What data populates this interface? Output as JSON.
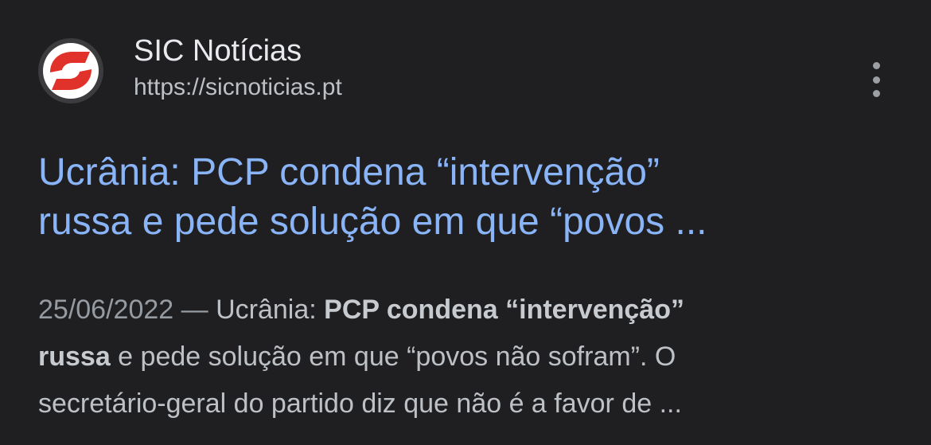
{
  "result": {
    "site_name": "SIC Notícias",
    "site_url": "https://sicnoticias.pt",
    "favicon_icon": "sic-logo-icon",
    "more_icon": "more-vert-icon",
    "title_line1": "Ucrânia: PCP condena “intervenção”",
    "title_line2": "russa e pede solução em que “povos ...",
    "snippet": {
      "date": "25/06/2022",
      "separator": " — ",
      "part1": "Ucrânia: ",
      "bold1": "PCP condena “intervenção”",
      "bold2": "russa",
      "part2": " e pede solução em que “povos não sofram”. O",
      "line3": "secretário-geral do partido diz que não é a favor de ..."
    }
  },
  "colors": {
    "background": "#1f1f21",
    "title_link": "#8ab4f8",
    "site_name": "#e8eaed",
    "text": "#bdc1c6",
    "logo_red": "#e0312b"
  }
}
